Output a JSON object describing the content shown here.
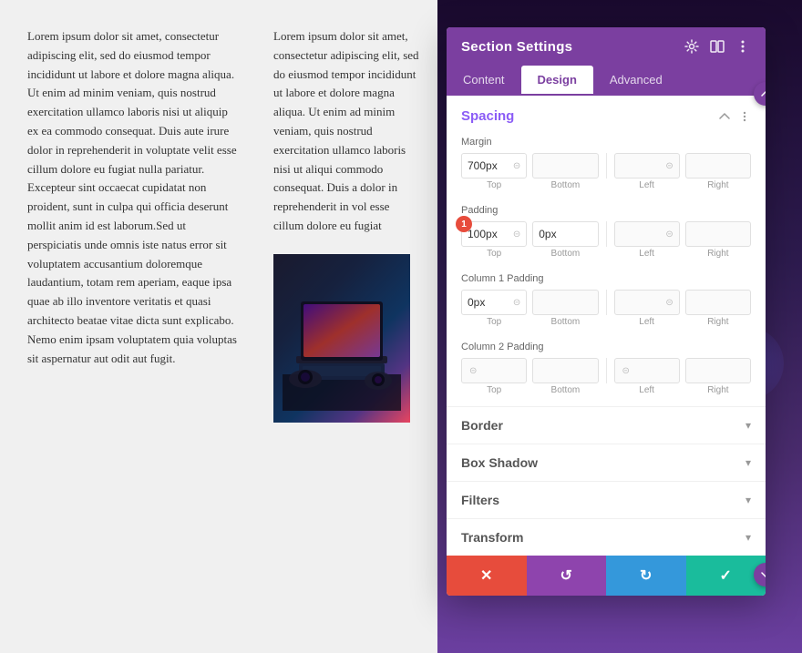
{
  "background": {
    "text_col1": "Lorem ipsum dolor sit amet, consectetur adipiscing elit, sed do eiusmod tempor incididunt ut labore et dolore magna aliqua. Ut enim ad minim veniam, quis nostrud exercitation ullamco laboris nisi ut aliquip ex ea commodo consequat. Duis aute irure dolor in reprehenderit in voluptate velit esse cillum dolore eu fugiat nulla pariatur. Excepteur sint occaecat cupidatat non proident, sunt in culpa qui officia deserunt mollit anim id est laborum.Sed ut perspiciatis unde omnis iste natus error sit voluptatem accusantium doloremque laudantium, totam rem aperiam, eaque ipsa quae ab illo inventore veritatis et quasi architecto beatae vitae dicta sunt explicabo. Nemo enim ipsam voluptatem quia voluptas sit aspernatur aut odit aut fugit.",
    "text_col2": "Lorem ipsum dolor sit amet, consectetur adipiscing elit, sed do eiusmod tempor incididunt ut labore et dolore magna aliqua. Ut enim ad minim veniam, quis nostrud exercitation ullamco laboris nisi ut aliqui commodo consequat. Duis a dolor in reprehenderit in vol esse cillum dolore eu fugiat"
  },
  "panel": {
    "title": "Section Settings",
    "tabs": [
      {
        "label": "Content",
        "active": false
      },
      {
        "label": "Design",
        "active": true
      },
      {
        "label": "Advanced",
        "active": false
      }
    ],
    "spacing": {
      "section_label": "Spacing",
      "margin": {
        "label": "Margin",
        "top_value": "700px",
        "bottom_value": "",
        "left_value": "",
        "right_value": "",
        "top_label": "Top",
        "bottom_label": "Bottom",
        "left_label": "Left",
        "right_label": "Right"
      },
      "padding": {
        "label": "Padding",
        "top_value": "100px",
        "bottom_value": "0px",
        "left_value": "",
        "right_value": "",
        "top_label": "Top",
        "bottom_label": "Bottom",
        "left_label": "Left",
        "right_label": "Right",
        "badge": "1"
      },
      "col1_padding": {
        "label": "Column 1 Padding",
        "top_value": "0px",
        "bottom_value": "",
        "left_value": "",
        "right_value": "",
        "top_label": "Top",
        "bottom_label": "Bottom",
        "left_label": "Left",
        "right_label": "Right"
      },
      "col2_padding": {
        "label": "Column 2 Padding",
        "top_value": "",
        "bottom_value": "",
        "left_value": "",
        "right_value": "",
        "top_label": "Top",
        "bottom_label": "Bottom",
        "left_label": "Left",
        "right_label": "Right"
      }
    },
    "collapsible": [
      {
        "label": "Border"
      },
      {
        "label": "Box Shadow"
      },
      {
        "label": "Filters"
      },
      {
        "label": "Transform"
      }
    ],
    "bottom_buttons": [
      {
        "label": "✕",
        "color": "btn-red",
        "name": "cancel-button"
      },
      {
        "label": "↺",
        "color": "btn-purple",
        "name": "undo-button"
      },
      {
        "label": "↻",
        "color": "btn-blue",
        "name": "redo-button"
      },
      {
        "label": "✓",
        "color": "btn-green",
        "name": "save-button"
      }
    ]
  }
}
